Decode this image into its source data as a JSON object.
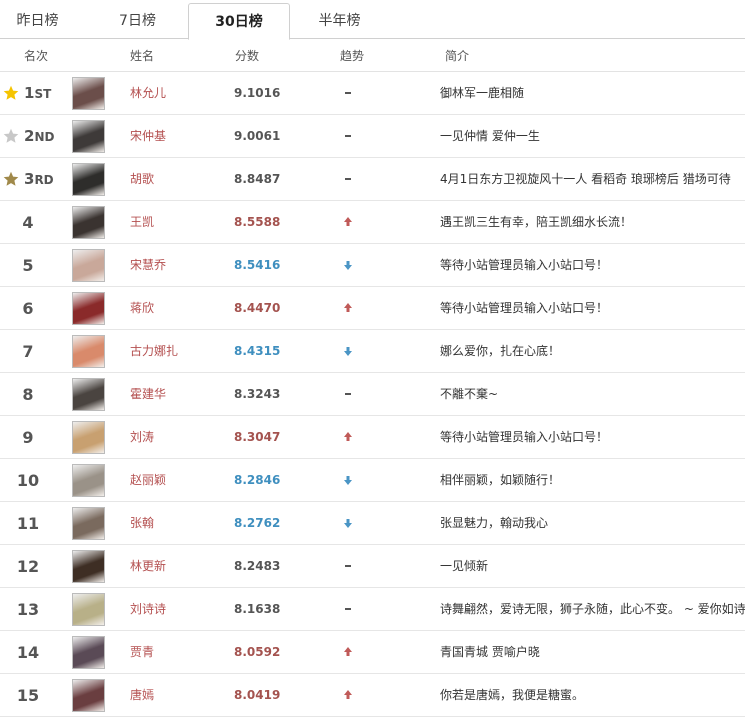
{
  "tabs": [
    {
      "label": "昨日榜",
      "active": false
    },
    {
      "label": "7日榜",
      "active": false
    },
    {
      "label": "30日榜",
      "active": true
    },
    {
      "label": "半年榜",
      "active": false
    }
  ],
  "columns": {
    "rank": "名次",
    "name": "姓名",
    "score": "分数",
    "trend": "趋势",
    "intro": "简介"
  },
  "colors": {
    "gold": "#f5c400",
    "silver": "#c8c8c8",
    "bronze": "#a0894a",
    "up": "#c05a58",
    "down": "#4a95c5",
    "flat": "#555555"
  },
  "rows": [
    {
      "rank": "1",
      "suffix": "ST",
      "medal": "gold",
      "avatar_color": "#6b4e4a",
      "name": "林允儿",
      "score": "9.1016",
      "score_color": "gray",
      "trend": "flat",
      "intro": "御林军一鹿相随"
    },
    {
      "rank": "2",
      "suffix": "ND",
      "medal": "silver",
      "avatar_color": "#3e3a39",
      "name": "宋仲基",
      "score": "9.0061",
      "score_color": "gray",
      "trend": "flat",
      "intro": "一见仲情 爱仲一生"
    },
    {
      "rank": "3",
      "suffix": "RD",
      "medal": "bronze",
      "avatar_color": "#2e2d2b",
      "name": "胡歌",
      "score": "8.8487",
      "score_color": "gray",
      "trend": "flat",
      "intro": "4月1日东方卫视旋风十一人 看稻奇 琅琊榜后 猎场可待"
    },
    {
      "rank": "4",
      "suffix": "",
      "medal": "",
      "avatar_color": "#3a3330",
      "name": "王凯",
      "score": "8.5588",
      "score_color": "red",
      "trend": "up",
      "intro": "遇王凯三生有幸，陪王凯细水长流！"
    },
    {
      "rank": "5",
      "suffix": "",
      "medal": "",
      "avatar_color": "#c9a89a",
      "name": "宋慧乔",
      "score": "8.5416",
      "score_color": "blue",
      "trend": "down",
      "intro": "等待小站管理员输入小站口号！"
    },
    {
      "rank": "6",
      "suffix": "",
      "medal": "",
      "avatar_color": "#8a2a2a",
      "name": "蒋欣",
      "score": "8.4470",
      "score_color": "red",
      "trend": "up",
      "intro": "等待小站管理员输入小站口号！"
    },
    {
      "rank": "7",
      "suffix": "",
      "medal": "",
      "avatar_color": "#d98a6b",
      "name": "古力娜扎",
      "score": "8.4315",
      "score_color": "blue",
      "trend": "down",
      "intro": "娜么爱你，扎在心底！"
    },
    {
      "rank": "8",
      "suffix": "",
      "medal": "",
      "avatar_color": "#4a4440",
      "name": "霍建华",
      "score": "8.3243",
      "score_color": "gray",
      "trend": "flat",
      "intro": "不離不棄~"
    },
    {
      "rank": "9",
      "suffix": "",
      "medal": "",
      "avatar_color": "#c8a070",
      "name": "刘涛",
      "score": "8.3047",
      "score_color": "red",
      "trend": "up",
      "intro": "等待小站管理员输入小站口号！"
    },
    {
      "rank": "10",
      "suffix": "",
      "medal": "",
      "avatar_color": "#9a9288",
      "name": "赵丽颖",
      "score": "8.2846",
      "score_color": "blue",
      "trend": "down",
      "intro": "相伴丽颖，如颖随行！"
    },
    {
      "rank": "11",
      "suffix": "",
      "medal": "",
      "avatar_color": "#7a6a5e",
      "name": "张翰",
      "score": "8.2762",
      "score_color": "blue",
      "trend": "down",
      "intro": "张显魅力，翰动我心"
    },
    {
      "rank": "12",
      "suffix": "",
      "medal": "",
      "avatar_color": "#3e2e24",
      "name": "林更新",
      "score": "8.2483",
      "score_color": "gray",
      "trend": "flat",
      "intro": "一见倾新"
    },
    {
      "rank": "13",
      "suffix": "",
      "medal": "",
      "avatar_color": "#b8b088",
      "name": "刘诗诗",
      "score": "8.1638",
      "score_color": "gray",
      "trend": "flat",
      "intro": "诗舞翩然，爱诗无限，狮子永随，此心不变。 ~ 爱你如诗"
    },
    {
      "rank": "14",
      "suffix": "",
      "medal": "",
      "avatar_color": "#5a4a56",
      "name": "贾青",
      "score": "8.0592",
      "score_color": "red",
      "trend": "up",
      "intro": "青国青城 贾喻户晓"
    },
    {
      "rank": "15",
      "suffix": "",
      "medal": "",
      "avatar_color": "#6a3e40",
      "name": "唐嫣",
      "score": "8.0419",
      "score_color": "red",
      "trend": "up",
      "intro": "你若是唐嫣，我便是糖蜜。"
    }
  ]
}
